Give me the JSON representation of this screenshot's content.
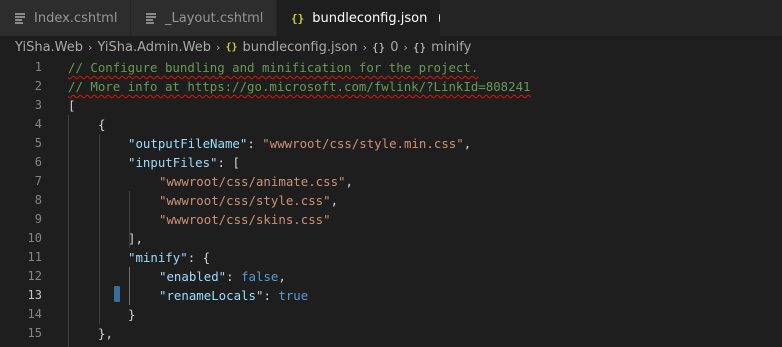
{
  "tabs": [
    {
      "label": "Index.cshtml",
      "icon": "lines-icon",
      "active": false
    },
    {
      "label": "_Layout.cshtml",
      "icon": "lines-icon",
      "active": false
    },
    {
      "label": "bundleconfig.json",
      "icon": "json-braces-icon",
      "active": true,
      "dirty": true
    }
  ],
  "tab_json_glyph": "{}",
  "breadcrumb": {
    "items": [
      "YiSha.Web",
      "YiSha.Admin.Web",
      "bundleconfig.json",
      "0",
      "minify"
    ],
    "json_glyph": "{}",
    "object_glyph": "{}"
  },
  "editor": {
    "line_numbers": [
      "1",
      "2",
      "3",
      "4",
      "5",
      "6",
      "7",
      "8",
      "9",
      "10",
      "11",
      "12",
      "13",
      "14",
      "15"
    ],
    "current_line": "13",
    "lines": {
      "l1": "// Configure bundling and minification for the project.",
      "l2": "// More info at https://go.microsoft.com/fwlink/?LinkId=808241",
      "l3": "[",
      "l4": "{",
      "l5_key": "\"outputFileName\"",
      "l5_colon": ": ",
      "l5_val": "\"wwwroot/css/style.min.css\"",
      "l5_comma": ",",
      "l6_key": "\"inputFiles\"",
      "l6_rest": ": [",
      "l7_val": "\"wwwroot/css/animate.css\"",
      "l8_val": "\"wwwroot/css/style.css\"",
      "l9_val": "\"wwwroot/css/skins.css\"",
      "l10": "],",
      "l11_key": "\"minify\"",
      "l11_rest": ": {",
      "l12_key": "\"enabled\"",
      "l12_colon": ": ",
      "l12_val": "false",
      "l13_key": "\"renameLocals\"",
      "l13_colon": ": ",
      "l13_val": "true",
      "l14": "}",
      "l15": "},"
    }
  },
  "colors": {
    "background": "#1e1e1e",
    "comment": "#6a9955",
    "key": "#9cdcfe",
    "string": "#ce9178",
    "keyword": "#569cd6",
    "json_icon": "#cbcb41"
  }
}
